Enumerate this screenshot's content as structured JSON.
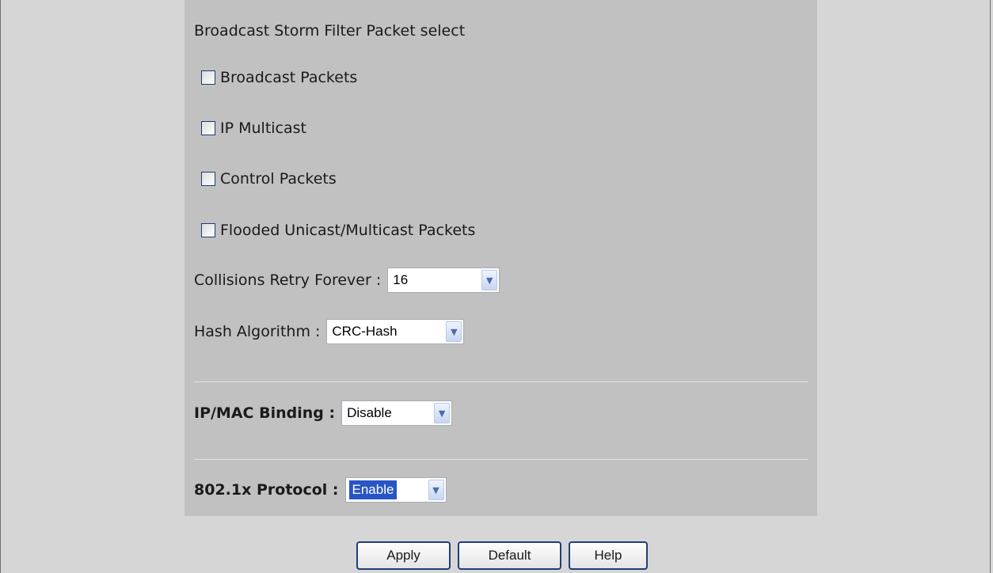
{
  "storm_filter": {
    "heading": "Broadcast Storm Filter Packet select",
    "options": [
      {
        "label": "Broadcast Packets",
        "checked": false
      },
      {
        "label": "IP Multicast",
        "checked": false
      },
      {
        "label": "Control Packets",
        "checked": false
      },
      {
        "label": "Flooded Unicast/Multicast Packets",
        "checked": false
      }
    ]
  },
  "collisions_retry": {
    "label": "Collisions Retry Forever :",
    "value": "16"
  },
  "hash_algorithm": {
    "label": "Hash Algorithm :",
    "value": "CRC-Hash"
  },
  "ip_mac_binding": {
    "label": "IP/MAC Binding :",
    "value": "Disable"
  },
  "protocol_8021x": {
    "label": "802.1x Protocol :",
    "value": "Enable"
  },
  "buttons": {
    "apply": "Apply",
    "default": "Default",
    "help": "Help"
  },
  "icons": {
    "dropdown": "chevron-down-icon"
  },
  "colors": {
    "panel_bg": "#c1c1c1",
    "page_bg": "#d6d6d6",
    "selection_highlight": "#2855c6",
    "button_border": "#1e3f7a"
  }
}
